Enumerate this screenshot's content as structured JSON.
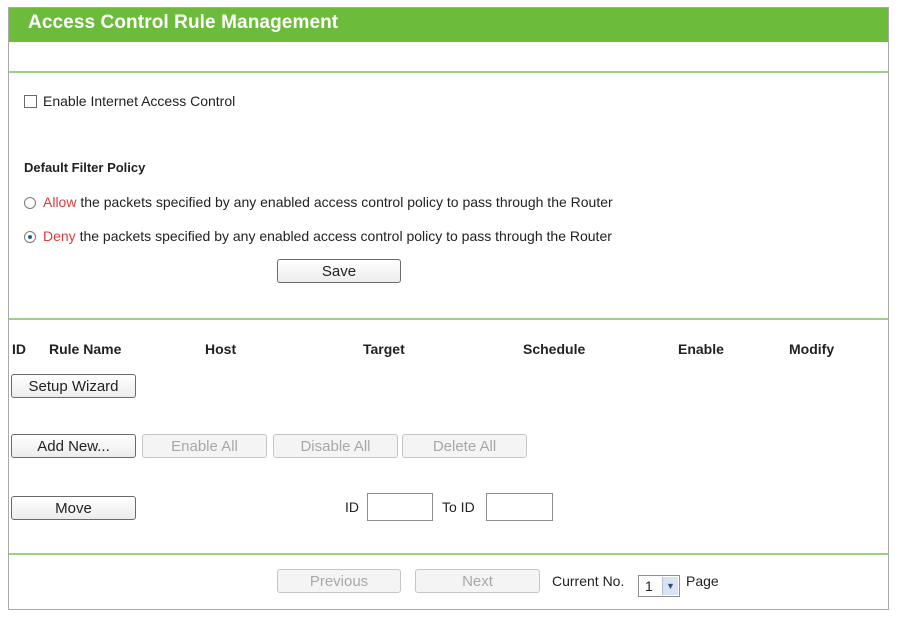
{
  "header": {
    "title": "Access Control Rule Management"
  },
  "enable_control": {
    "label": "Enable Internet Access Control",
    "checked": false
  },
  "policy": {
    "heading": "Default Filter Policy",
    "options": [
      {
        "keyword": "Allow",
        "rest": " the packets specified by any enabled access control policy to pass through the Router",
        "selected": false
      },
      {
        "keyword": "Deny",
        "rest": " the packets specified by any enabled access control policy to pass through the Router",
        "selected": true
      }
    ],
    "save_label": "Save"
  },
  "table": {
    "columns": [
      "ID",
      "Rule Name",
      "Host",
      "Target",
      "Schedule",
      "Enable",
      "Modify"
    ]
  },
  "actions": {
    "setup_wizard": "Setup Wizard",
    "add_new": "Add New...",
    "enable_all": "Enable All",
    "disable_all": "Disable All",
    "delete_all": "Delete All"
  },
  "move": {
    "button_label": "Move",
    "id_label": "ID",
    "to_id_label": "To ID",
    "id_value": "",
    "to_id_value": ""
  },
  "pagination": {
    "previous": "Previous",
    "next": "Next",
    "current_label": "Current No.",
    "current_value": "1",
    "page_label": "Page"
  },
  "colors": {
    "title_bar": "#6dbb3a",
    "divider": "#9fcf84",
    "policy_keyword": "#e03b3b"
  }
}
